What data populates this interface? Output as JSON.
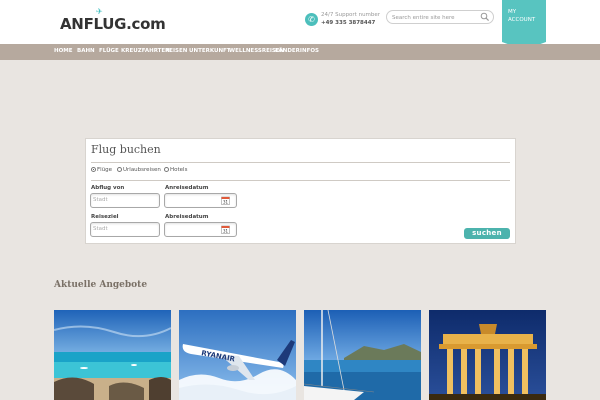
{
  "header": {
    "logo": "ANFLUG.com",
    "support_label": "24/7 Support number",
    "support_number": "+49 335 3878447",
    "search_placeholder": "Search entire site here",
    "account_line1": "MY",
    "account_line2": "ACCOUNT"
  },
  "nav": {
    "items": [
      "HOME",
      "BAHN",
      "FLÜGE",
      "KREUZFAHRTEN",
      "REISEN",
      "UNTERKUNFT",
      "WELLNESSREISEN",
      "LÄNDERINFOS"
    ],
    "active_index": 0
  },
  "booking": {
    "title": "Flug buchen",
    "radios": [
      {
        "label": "Flüge",
        "selected": true
      },
      {
        "label": "Urlaubsreisen",
        "selected": false
      },
      {
        "label": "Hotels",
        "selected": false
      }
    ],
    "from_label": "Abflug von",
    "from_placeholder": "Stadt",
    "depart_label": "Anreisedatum",
    "dest_label": "Reiseziel",
    "dest_placeholder": "Stadt",
    "return_label": "Abreisedatum",
    "calendar_number": "31",
    "submit_label": "suchen"
  },
  "offers": {
    "title": "Aktuelle Angebote",
    "images": [
      "beach-photo",
      "ryanair-plane-photo",
      "sailboat-photo",
      "brandenburg-gate-photo"
    ],
    "plane_text": "RYANAIR"
  },
  "colors": {
    "accent": "#58c4c0",
    "nav_bg": "#b6a99e",
    "page_bg": "#e9e5e1",
    "button": "#4cb3ad"
  }
}
